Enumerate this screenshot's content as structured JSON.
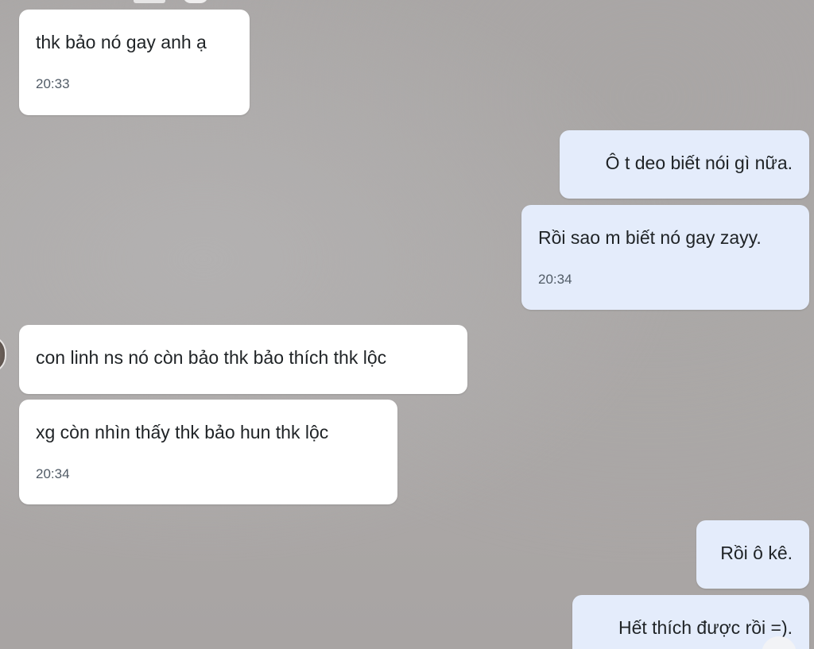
{
  "messages": [
    {
      "side": "received",
      "text": "thk bảo nó gay anh ạ",
      "time": "20:33"
    },
    {
      "side": "sent",
      "text": "Ô t deo biết nói gì nữa."
    },
    {
      "side": "sent",
      "text": "Rồi sao m biết nó gay zayy.",
      "time": "20:34"
    },
    {
      "side": "received",
      "text": "con linh ns nó còn bảo thk bảo thích thk lộc"
    },
    {
      "side": "received",
      "text": "xg còn nhìn thấy thk bảo hun thk lộc",
      "time": "20:34"
    },
    {
      "side": "sent",
      "text": "Rồi ô kê."
    },
    {
      "side": "sent",
      "text": "Hết thích được rồi =)."
    }
  ],
  "colors": {
    "received_bubble": "#ffffff",
    "sent_bubble": "#e4ecfb",
    "timestamp": "#515b66",
    "background": "#aaa7a6"
  }
}
